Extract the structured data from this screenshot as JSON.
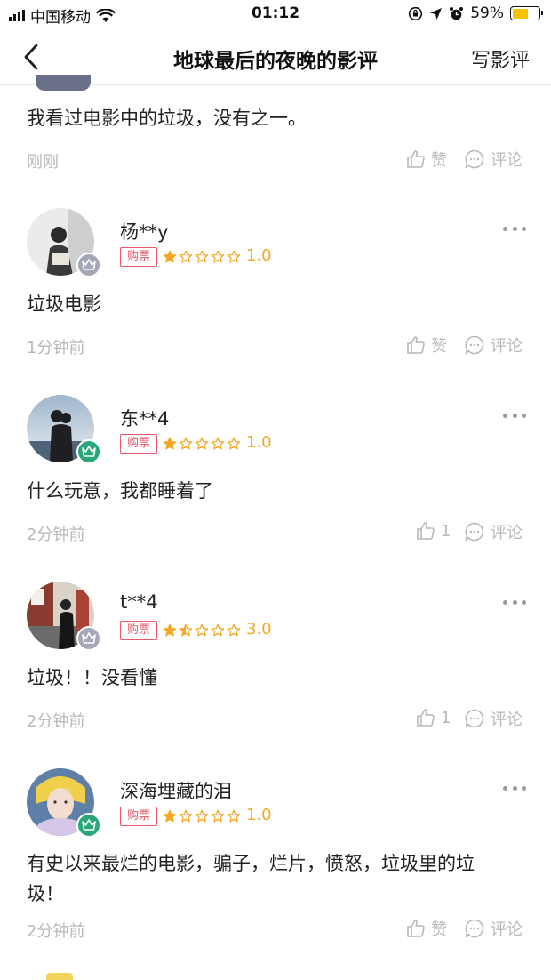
{
  "status_bar": {
    "carrier": "中国移动",
    "time": "01:12",
    "battery_percent": "59%",
    "battery_level": 0.59,
    "battery_color": "#f5c400"
  },
  "nav": {
    "back_icon": "chevron-left-icon",
    "title": "地球最后的夜晚的影评",
    "action_label": "写影评"
  },
  "colors": {
    "star": "#f5a623",
    "ticket_tag": "#e85a6a",
    "meta_text": "#b8b8b8",
    "badge_gray": "#a3a7b8",
    "badge_green": "#2aa779"
  },
  "reviews": [
    {
      "partial": true,
      "content": "我看过电影中的垃圾，没有之一。",
      "time": "刚刚",
      "like_label": "赞",
      "comment_label": "评论"
    },
    {
      "username": "杨**y",
      "ticket_tag": "购票",
      "rating_stars": 1,
      "score": "1.0",
      "content": "垃圾电影",
      "time": "1分钟前",
      "like_label": "赞",
      "comment_label": "评论",
      "level_badge": "gray"
    },
    {
      "username": "东**4",
      "ticket_tag": "购票",
      "rating_stars": 1,
      "score": "1.0",
      "content": "什么玩意，我都睡着了",
      "time": "2分钟前",
      "like_label": "1",
      "comment_label": "评论",
      "level_badge": "green"
    },
    {
      "username": "t**4",
      "ticket_tag": "购票",
      "rating_stars": 1.5,
      "score": "3.0",
      "content": "垃圾！！没看懂",
      "time": "2分钟前",
      "like_label": "1",
      "comment_label": "评论",
      "level_badge": "gray"
    },
    {
      "username": "深海埋藏的泪",
      "ticket_tag": "购票",
      "rating_stars": 1,
      "score": "1.0",
      "content": "有史以来最烂的电影，骗子，烂片，愤怒，垃圾里的垃圾！",
      "time": "2分钟前",
      "like_label": "赞",
      "comment_label": "评论",
      "level_badge": "green"
    }
  ]
}
